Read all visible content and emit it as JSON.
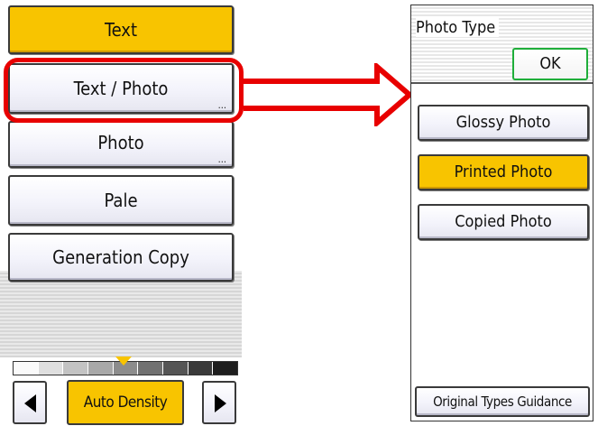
{
  "left_panel": {
    "modes": [
      {
        "label": "Text",
        "selected": true,
        "has_more": false
      },
      {
        "label": "Text / Photo",
        "selected": false,
        "has_more": true
      },
      {
        "label": "Photo",
        "selected": false,
        "has_more": true
      },
      {
        "label": "Pale",
        "selected": false,
        "has_more": false
      },
      {
        "label": "Generation Copy",
        "selected": false,
        "has_more": false
      }
    ],
    "more_indicator": "...",
    "density": {
      "label": "Auto Density",
      "scale_segments": 9,
      "pointer_level": 5
    }
  },
  "right_panel": {
    "title": "Photo Type",
    "ok_label": "OK",
    "photo_types": [
      {
        "label": "Glossy Photo",
        "selected": false
      },
      {
        "label": "Printed Photo",
        "selected": true
      },
      {
        "label": "Copied Photo",
        "selected": false
      }
    ],
    "guidance_label": "Original Types Guidance"
  },
  "colors": {
    "selected": "#f8c400",
    "highlight": "#e80000",
    "ok_border": "#1fae3a"
  }
}
